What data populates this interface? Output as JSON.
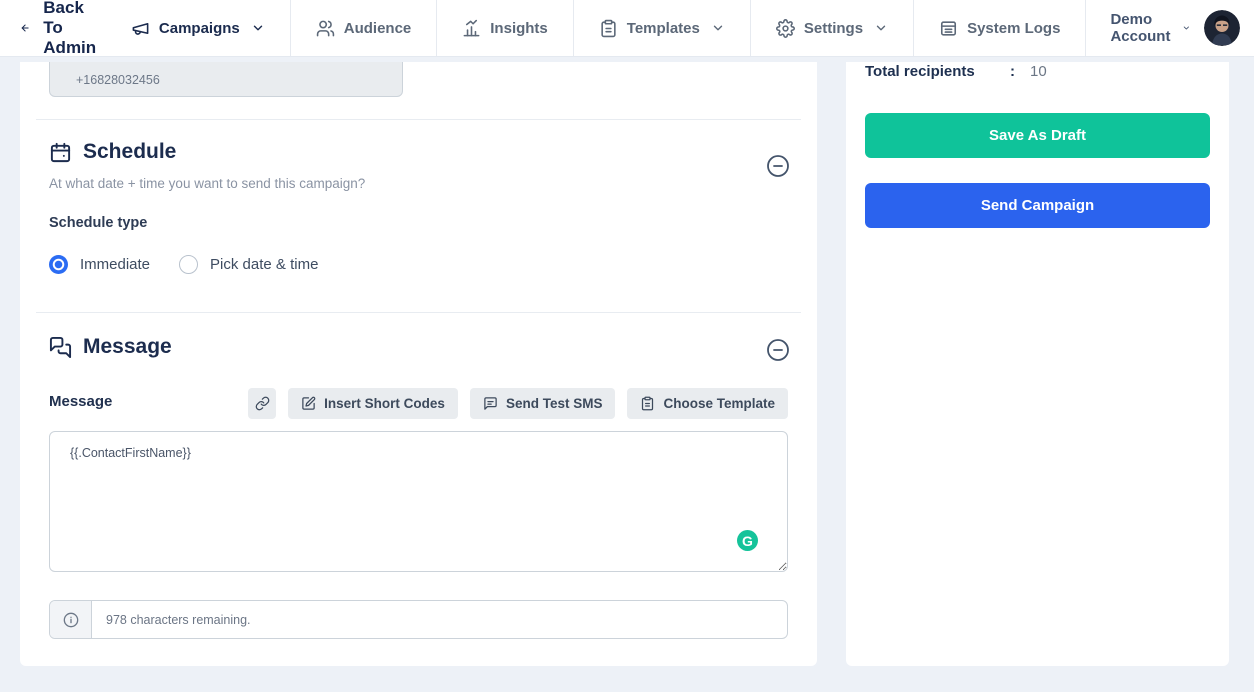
{
  "nav": {
    "back_label": "Back To Admin",
    "items": [
      {
        "label": "Campaigns",
        "icon": "megaphone-icon",
        "has_dropdown": true,
        "active": true
      },
      {
        "label": "Audience",
        "icon": "audience-people-icon",
        "has_dropdown": false,
        "active": false
      },
      {
        "label": "Insights",
        "icon": "insights-chart-icon",
        "has_dropdown": false,
        "active": false
      },
      {
        "label": "Templates",
        "icon": "templates-clipboard-icon",
        "has_dropdown": true,
        "active": false
      },
      {
        "label": "Settings",
        "icon": "settings-gear-icon",
        "has_dropdown": true,
        "active": false
      },
      {
        "label": "System Logs",
        "icon": "system-logs-icon",
        "has_dropdown": false,
        "active": false
      }
    ],
    "account": {
      "label": "Demo Account",
      "has_dropdown": true,
      "avatar": "user-photo"
    }
  },
  "campaign_form": {
    "phone_number": "+16828032456",
    "schedule": {
      "title": "Schedule",
      "subtitle": "At what date + time you want to send this campaign?",
      "type_label": "Schedule type",
      "options": [
        {
          "label": "Immediate",
          "selected": true
        },
        {
          "label": "Pick date & time",
          "selected": false
        }
      ]
    },
    "message": {
      "title": "Message",
      "field_label": "Message",
      "toolbar": {
        "link_button_icon": "link-icon",
        "insert_short_codes": "Insert Short Codes",
        "send_test_sms": "Send Test SMS",
        "choose_template": "Choose Template"
      },
      "body": "{{.ContactFirstName}}",
      "chars_remaining": "978 characters remaining.",
      "grammarly_badge": "G"
    }
  },
  "summary": {
    "total_recipients_label": "Total recipients",
    "colon": ":",
    "total_recipients_value": "10",
    "save_as_draft_label": "Save As Draft",
    "send_campaign_label": "Send Campaign"
  },
  "colors": {
    "primary_blue": "#2b63ee",
    "success_green": "#0fc39a",
    "navy_heading": "#1b2b4e",
    "radio_blue": "#2b6cf3",
    "grammarly_green": "#15c39a",
    "page_background": "#edf1f7"
  }
}
